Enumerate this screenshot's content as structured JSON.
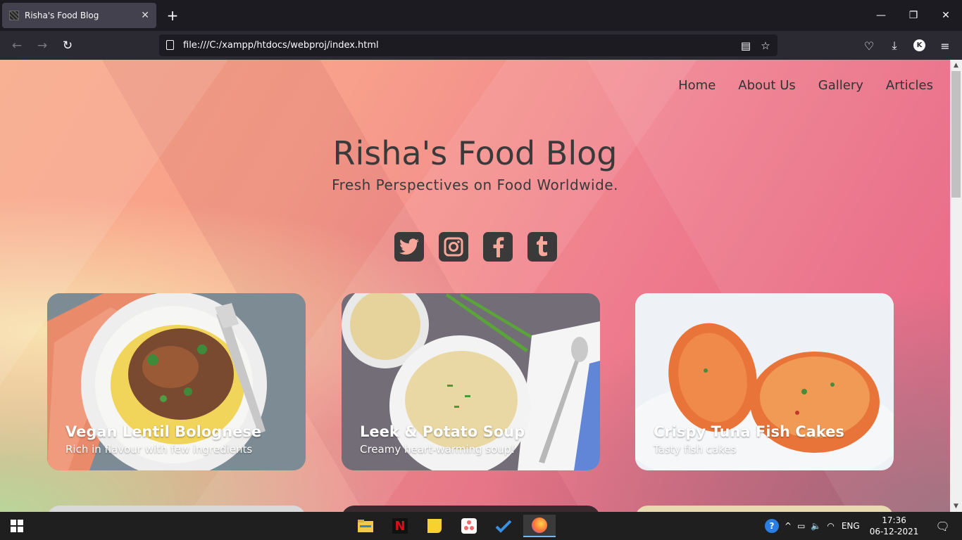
{
  "browser": {
    "tab_title": "Risha's Food Blog",
    "tab_close": "✕",
    "new_tab": "+",
    "window_controls": {
      "minimize": "—",
      "restore": "❐",
      "close": "✕"
    },
    "nav": {
      "back": "←",
      "forward": "→",
      "reload": "↻"
    },
    "url": "file:///C:/xampp/htdocs/webproj/index.html",
    "profile_initial": "K"
  },
  "site": {
    "nav": [
      "Home",
      "About Us",
      "Gallery",
      "Articles"
    ],
    "title": "Risha's Food Blog",
    "tagline": "Fresh Perspectives on Food Worldwide.",
    "socials": [
      {
        "icon": "twitter-icon",
        "glyph": "🐦"
      },
      {
        "icon": "instagram-icon",
        "glyph": "◎"
      },
      {
        "icon": "facebook-icon",
        "glyph": "f"
      },
      {
        "icon": "tumblr-icon",
        "glyph": "t"
      }
    ],
    "cards": [
      {
        "title": "Vegan Lentil Bolognese",
        "subtitle": "Rich in flavour with few ingredients"
      },
      {
        "title": "Leek & Potato Soup",
        "subtitle": "Creamy heart-warming soup!"
      },
      {
        "title": "Crispy Tuna Fish Cakes",
        "subtitle": "Tasty fish cakes"
      }
    ]
  },
  "taskbar": {
    "language": "ENG",
    "time": "17:36",
    "date": "06-12-2021"
  }
}
